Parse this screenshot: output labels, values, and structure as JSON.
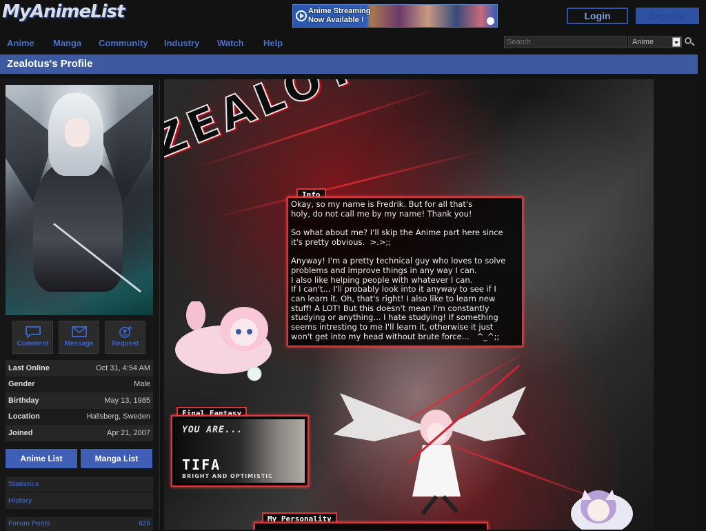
{
  "header": {
    "logo": "MyAnimeList",
    "banner": "Anime Streaming\nNow Available !",
    "login": "Login",
    "signup": "Sign Up"
  },
  "nav": {
    "items": [
      "Anime",
      "Manga",
      "Community",
      "Industry",
      "Watch",
      "Help"
    ],
    "search_placeholder": "Search",
    "search_type": "Anime"
  },
  "page": {
    "title": "Zealotus's Profile"
  },
  "sidebar": {
    "actions": [
      "Comment",
      "Message",
      "Request"
    ],
    "details": [
      {
        "label": "Last Online",
        "value": "Oct 31, 4:54 AM"
      },
      {
        "label": "Gender",
        "value": "Male"
      },
      {
        "label": "Birthday",
        "value": "May 13, 1985"
      },
      {
        "label": "Location",
        "value": "Hallsberg, Sweden"
      },
      {
        "label": "Joined",
        "value": "Apr 21, 2007"
      }
    ],
    "anime_list": "Anime List",
    "manga_list": "Manga List",
    "links": [
      "Statistics",
      "History"
    ],
    "forum_posts_label": "Forum Posts",
    "forum_posts_value": "626"
  },
  "main": {
    "banner_text": "ZEALOTUS",
    "info_tab": "Info",
    "info_text": "Okay, so my name is Fredrik. But for all that's\nholy, do not call me by my name! Thank you!\n\nSo what about me? I'll skip the Anime part here since\nit's pretty obvious.  >.>;;\n\nAnyway! I'm a pretty technical guy who loves to solve\nproblems and improve things in any way I can.\nI also like helping people with whatever I can.\nIf I can't... I'll probably look into it anyway to see if I\ncan learn it. Oh, that's right! I also like to learn new\nstuff! A LOT! But this doesn't mean I'm constantly\nstudying or anything... I hate studying! If something\nseems intresting to me I'll learn it, otherwise it just\nwon't get into my head without brute force...   ^_^;;",
    "ff_tab": "Final Fantasy",
    "ff_you_are": "YOU ARE...",
    "ff_name": "TIFA",
    "ff_sub": "BRIGHT AND OPTIMISTIC",
    "personality_tab": "My Personality"
  }
}
